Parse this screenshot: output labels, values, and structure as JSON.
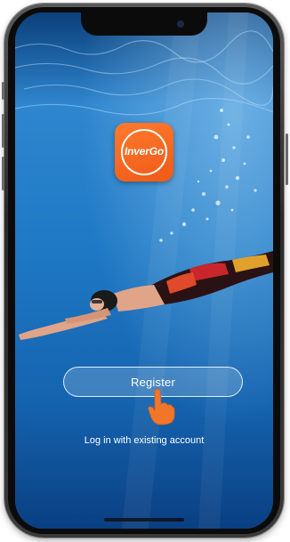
{
  "app": {
    "logo_text": "InverGo"
  },
  "actions": {
    "register_label": "Register",
    "login_label": "Log in with existing account"
  },
  "colors": {
    "logo_orange": "#ef5a17",
    "water_top": "#0b3f7a",
    "water_mid": "#1f79c4",
    "water_bottom": "#0a3f82"
  },
  "icons": {
    "pointer": "pointing-hand-icon",
    "notch_camera": "camera-icon"
  }
}
